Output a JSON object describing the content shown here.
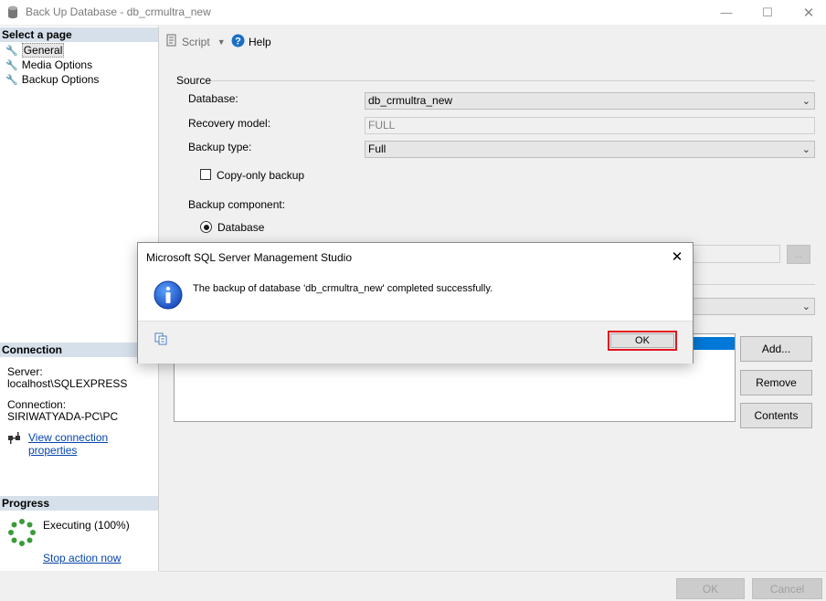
{
  "window": {
    "title": "Back Up Database - db_crmultra_new"
  },
  "left": {
    "select_page_header": "Select a page",
    "pages": [
      "General",
      "Media Options",
      "Backup Options"
    ],
    "connection_header": "Connection",
    "server_label": "Server:",
    "server_value": "localhost\\SQLEXPRESS",
    "connection_label": "Connection:",
    "connection_value": "SIRIWATYADA-PC\\PC",
    "view_props_link": "View connection properties",
    "progress_header": "Progress",
    "progress_status": "Executing (100%)",
    "stop_link": "Stop action now"
  },
  "toolbar": {
    "script_label": "Script",
    "help_label": "Help"
  },
  "main": {
    "source_header": "Source",
    "database_label": "Database:",
    "database_value": "db_crmultra_new",
    "recovery_label": "Recovery model:",
    "recovery_value": "FULL",
    "backup_type_label": "Backup type:",
    "backup_type_value": "Full",
    "copy_only_label": "Copy-only backup",
    "component_label": "Backup component:",
    "component_database": "Database",
    "browse_label": "...",
    "add_label": "Add...",
    "remove_label": "Remove",
    "contents_label": "Contents"
  },
  "footer": {
    "ok_label": "OK",
    "cancel_label": "Cancel"
  },
  "dialog": {
    "title": "Microsoft SQL Server Management Studio",
    "message": "The backup of database 'db_crmultra_new' completed successfully.",
    "ok_label": "OK",
    "highlight_color": "#e0141e"
  }
}
